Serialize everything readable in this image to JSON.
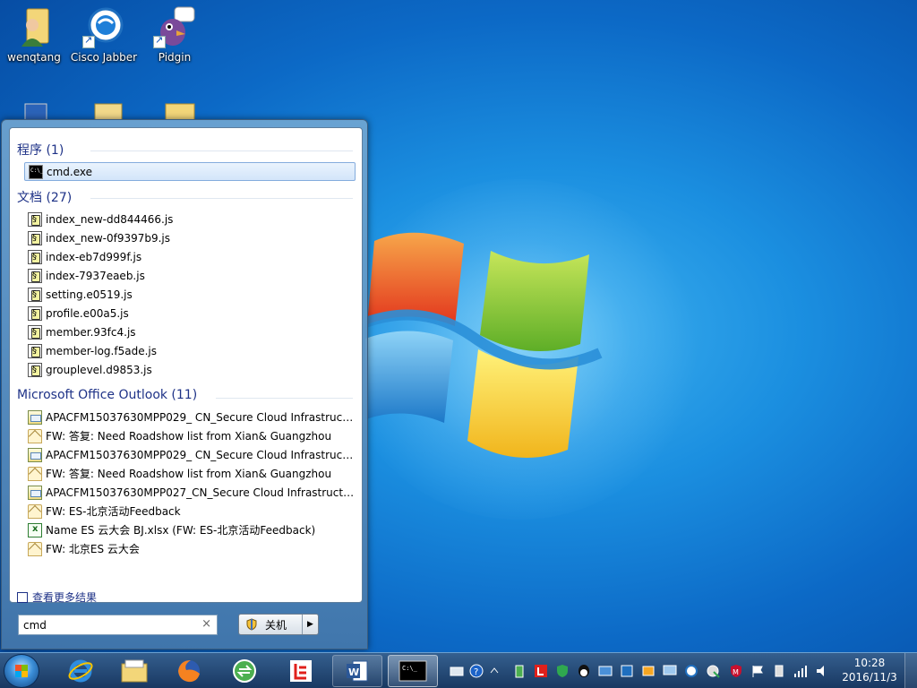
{
  "desktop": {
    "icons": [
      {
        "label": "wenqtang",
        "icon": "user-folder-icon"
      },
      {
        "label": "Cisco Jabber",
        "icon": "cisco-jabber-icon"
      },
      {
        "label": "Pidgin",
        "icon": "pidgin-icon"
      }
    ]
  },
  "start_menu": {
    "groups": [
      {
        "title": "程序 (1)",
        "items": [
          {
            "label": "cmd.exe",
            "icon": "cmd-icon",
            "selected": true
          }
        ]
      },
      {
        "title": "文档 (27)",
        "items": [
          {
            "label": "index_new-dd844466.js",
            "icon": "script-file-icon"
          },
          {
            "label": "index_new-0f9397b9.js",
            "icon": "script-file-icon"
          },
          {
            "label": "index-eb7d999f.js",
            "icon": "script-file-icon"
          },
          {
            "label": "index-7937eaeb.js",
            "icon": "script-file-icon"
          },
          {
            "label": "setting.e0519.js",
            "icon": "script-file-icon"
          },
          {
            "label": "profile.e00a5.js",
            "icon": "script-file-icon"
          },
          {
            "label": "member.93fc4.js",
            "icon": "script-file-icon"
          },
          {
            "label": "member-log.f5ade.js",
            "icon": "script-file-icon"
          },
          {
            "label": "grouplevel.d9853.js",
            "icon": "script-file-icon"
          }
        ]
      },
      {
        "title": "Microsoft Office Outlook (11)",
        "items": [
          {
            "label": "APACFM15037630MPP029_ CN_Secure Cloud Infrastructu...",
            "icon": "meeting-icon"
          },
          {
            "label": "FW: 答复: Need Roadshow list from Xian& Guangzhou",
            "icon": "mail-open-icon"
          },
          {
            "label": "APACFM15037630MPP029_ CN_Secure Cloud Infrastructu...",
            "icon": "meeting-icon"
          },
          {
            "label": "FW: 答复: Need Roadshow list from Xian& Guangzhou",
            "icon": "mail-open-icon"
          },
          {
            "label": "APACFM15037630MPP027_CN_Secure Cloud Infrastructur...",
            "icon": "meeting-icon"
          },
          {
            "label": "FW: ES-北京活动Feedback",
            "icon": "mail-open-icon"
          },
          {
            "label": "Name ES 云大会 BJ.xlsx (FW: ES-北京活动Feedback)",
            "icon": "excel-attachment-icon"
          },
          {
            "label": "FW: 北京ES 云大会",
            "icon": "mail-open-icon"
          }
        ]
      }
    ],
    "see_more": "查看更多结果",
    "search": {
      "value": "cmd",
      "clear": "×"
    },
    "shutdown_label": "关机",
    "shutdown_arrow": "▶"
  },
  "taskbar": {
    "pinned": [
      {
        "name": "internet-explorer-icon"
      },
      {
        "name": "file-explorer-icon"
      },
      {
        "name": "firefox-icon"
      },
      {
        "name": "sync-app-icon"
      },
      {
        "name": "letv-icon"
      },
      {
        "name": "word-icon"
      },
      {
        "name": "cmd-window-icon"
      }
    ],
    "clock": {
      "time": "10:28",
      "date": "2016/11/3"
    }
  },
  "colors": {
    "group_title": "#1e3287",
    "accent": "#3b8ed8"
  }
}
